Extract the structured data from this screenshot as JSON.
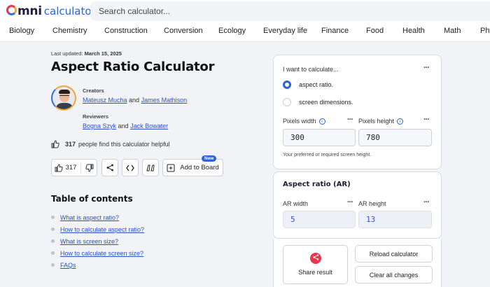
{
  "brand": {
    "logo_prefix": "omni",
    "logo_suffix": "calculator"
  },
  "search": {
    "placeholder": "Search calculator..."
  },
  "nav": {
    "items": [
      "Biology",
      "Chemistry",
      "Construction",
      "Conversion",
      "Ecology",
      "Everyday life",
      "Finance",
      "Food",
      "Health",
      "Math",
      "Phy"
    ]
  },
  "article": {
    "updated_label": "Last updated:",
    "updated_date": "March 15, 2025",
    "title": "Aspect Ratio Calculator",
    "creators_label": "Creators",
    "creators": [
      "Mateusz Mucha",
      "James Mathison"
    ],
    "reviewers_label": "Reviewers",
    "reviewers": [
      "Bogna Szyk",
      "Jack Bowater"
    ],
    "and": "and",
    "helpful_count": "317",
    "helpful_text": "people find this calculator helpful",
    "like_count": "317",
    "add_to_board": "Add to Board",
    "new_badge": "New"
  },
  "toc": {
    "title": "Table of contents",
    "items": [
      "What is aspect ratio?",
      "How to calculate aspect ratio?",
      "What is screen size?",
      "How to calculate screen size?",
      "FAQs"
    ]
  },
  "calculator": {
    "want_label": "I want to calculate...",
    "options": [
      "aspect ratio.",
      "screen dimensions."
    ],
    "selected_option": "aspect ratio.",
    "pixels_width_label": "Pixels width",
    "pixels_width_value": "300",
    "pixels_height_label": "Pixels height",
    "pixels_height_value": "780",
    "hint": "Your preferred or required screen height.",
    "ar_section_title": "Aspect ratio (AR)",
    "ar_width_label": "AR width",
    "ar_width_value": "5",
    "ar_height_label": "AR height",
    "ar_height_value": "13",
    "share_label": "Share result",
    "reload_label": "Reload calculator",
    "clear_label": "Clear all changes"
  },
  "colors": {
    "accent": "#2b64d8",
    "link": "#2b50c8",
    "brand_red": "#e8374d",
    "page_bg": "#f2f3f7"
  }
}
